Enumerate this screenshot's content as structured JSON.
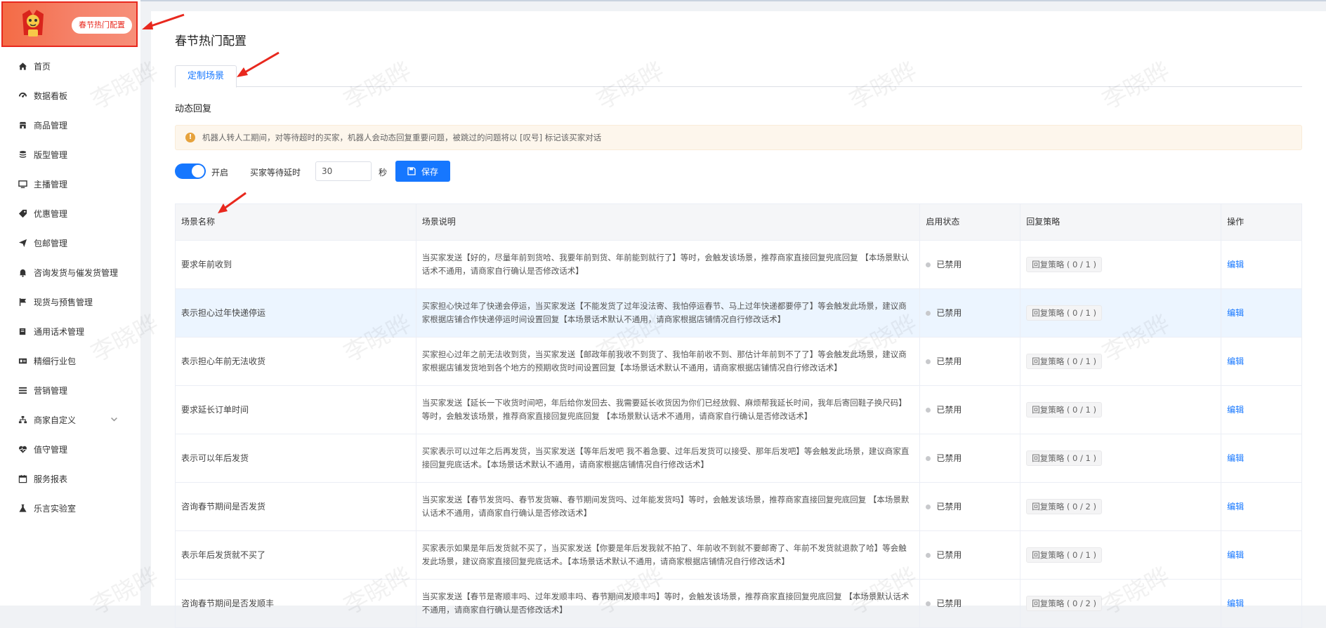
{
  "brand": {
    "badge": "春节热门配置"
  },
  "sidebar": {
    "items": [
      {
        "label": "首页",
        "icon": "home-icon"
      },
      {
        "label": "数据看板",
        "icon": "dashboard-icon"
      },
      {
        "label": "商品管理",
        "icon": "shop-icon"
      },
      {
        "label": "版型管理",
        "icon": "layers-icon"
      },
      {
        "label": "主播管理",
        "icon": "monitor-icon"
      },
      {
        "label": "优惠管理",
        "icon": "tag-icon"
      },
      {
        "label": "包邮管理",
        "icon": "send-icon"
      },
      {
        "label": "咨询发货与催发货管理",
        "icon": "bell-icon"
      },
      {
        "label": "现货与预售管理",
        "icon": "flag-icon"
      },
      {
        "label": "通用话术管理",
        "icon": "book-icon"
      },
      {
        "label": "精细行业包",
        "icon": "card-icon"
      },
      {
        "label": "营销管理",
        "icon": "list-icon"
      },
      {
        "label": "商家自定义",
        "icon": "sitemap-icon"
      },
      {
        "label": "值守管理",
        "icon": "heartbeat-icon"
      },
      {
        "label": "服务报表",
        "icon": "calendar-icon"
      },
      {
        "label": "乐言实验室",
        "icon": "flask-icon"
      }
    ]
  },
  "page": {
    "title": "春节热门配置",
    "tab": "定制场景",
    "section": "动态回复",
    "notice": "机器人转人工期间，对等待超时的买家，机器人会动态回复重要问题，被跳过的问题将以 [叹号] 标记该买家对话"
  },
  "controls": {
    "toggle_label": "开启",
    "wait_label": "买家等待延时",
    "wait_value": "30",
    "unit": "秒",
    "save": "保存"
  },
  "table": {
    "headers": [
      "场景名称",
      "场景说明",
      "启用状态",
      "回复策略",
      "操作"
    ],
    "rows": [
      {
        "name": "要求年前收到",
        "desc": "当买家发送【好的，尽量年前到货哈、我要年前到货、年前能到就行了】等时，会触发该场景，推荐商家直接回复兜底回复 【本场景默认话术不通用，请商家自行确认是否修改话术】",
        "status": "已禁用",
        "strategy": "回复策略 ( 0 / 1 )",
        "action": "编辑"
      },
      {
        "name": "表示担心过年快递停运",
        "desc": "买家担心快过年了快递会停运，当买家发送【不能发货了过年没法寄、我怕停运春节、马上过年快递都要停了】等会触发此场景，建议商家根据店铺合作快递停运时间设置回复【本场景话术默认不通用，请商家根据店铺情况自行修改话术】",
        "status": "已禁用",
        "strategy": "回复策略 ( 0 / 1 )",
        "action": "编辑"
      },
      {
        "name": "表示担心年前无法收货",
        "desc": "买家担心过年之前无法收到货，当买家发送【邮政年前我收不到货了、我怕年前收不到、那估计年前到不了了】等会触发此场景，建议商家根据店铺发货地到各个地方的预期收货时间设置回复【本场景话术默认不通用，请商家根据店铺情况自行修改话术】",
        "status": "已禁用",
        "strategy": "回复策略 ( 0 / 1 )",
        "action": "编辑"
      },
      {
        "name": "要求延长订单时间",
        "desc": "当买家发送【延长一下收货时间吧，年后给你发回去、我需要延长收货因为你们已经放假、麻烦帮我延长时间，我年后寄回鞋子换尺码】等时，会触发该场景，推荐商家直接回复兜底回复 【本场景默认话术不通用，请商家自行确认是否修改话术】",
        "status": "已禁用",
        "strategy": "回复策略 ( 0 / 1 )",
        "action": "编辑"
      },
      {
        "name": "表示可以年后发货",
        "desc": "买家表示可以过年之后再发货，当买家发送【等年后发吧 我不着急要、过年后发货可以接受、那年后发吧】等会触发此场景，建议商家直接回复兜底话术。【本场景话术默认不通用，请商家根据店铺情况自行修改话术】",
        "status": "已禁用",
        "strategy": "回复策略 ( 0 / 1 )",
        "action": "编辑"
      },
      {
        "name": "咨询春节期间是否发货",
        "desc": "当买家发送【春节发货吗、春节发货嘛、春节期间发货吗、过年能发货吗】等时，会触发该场景，推荐商家直接回复兜底回复 【本场景默认话术不通用，请商家自行确认是否修改话术】",
        "status": "已禁用",
        "strategy": "回复策略 ( 0 / 2 )",
        "action": "编辑"
      },
      {
        "name": "表示年后发货就不买了",
        "desc": "买家表示如果是年后发货就不买了，当买家发送【你要是年后发我就不拍了、年前收不到就不要邮寄了、年前不发货就退款了哈】等会触发此场景，建议商家直接回复兜底话术。【本场景话术默认不通用，请商家根据店铺情况自行修改话术】",
        "status": "已禁用",
        "strategy": "回复策略 ( 0 / 1 )",
        "action": "编辑"
      },
      {
        "name": "咨询春节期间是否发顺丰",
        "desc": "当买家发送【春节是寄顺丰吗、过年发顺丰吗、春节期间发顺丰吗】等时，会触发该场景，推荐商家直接回复兜底回复 【本场景默认话术不通用，请商家自行确认是否修改话术】",
        "status": "已禁用",
        "strategy": "回复策略 ( 0 / 2 )",
        "action": "编辑"
      }
    ]
  },
  "watermark": "李晓晔",
  "colors": {
    "accent": "#1677ff",
    "brand": "#e8281e",
    "notice_bg": "#fdf6ec",
    "highlight_row": "#ecf5ff"
  }
}
